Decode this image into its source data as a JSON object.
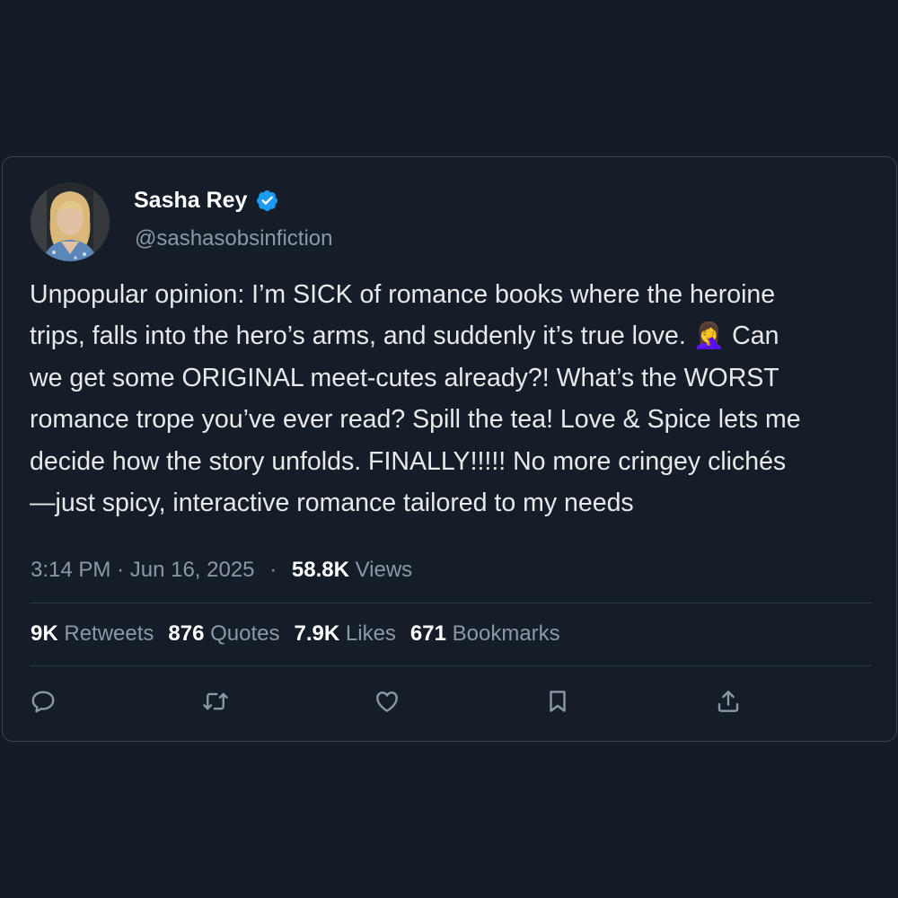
{
  "tweet": {
    "display_name": "Sasha Rey",
    "verified": true,
    "handle": "@sashasobsinfiction",
    "text": "Unpopular opinion: I’m SICK of romance books where the heroine\ntrips, falls into the hero’s arms, and suddenly it’s true love. 🤦‍♀️  Can\nwe get some ORIGINAL meet-cutes already?! What’s the WORST\nromance trope you’ve ever read? Spill the tea! Love & Spice lets me\ndecide how the story unfolds. FINALLY!!!!! No more cringey clichés\n—just spicy, interactive romance tailored to my needs",
    "time": "3:14 PM",
    "date": "Jun 16, 2025",
    "separator": "·",
    "views_count": "58.8K",
    "views_label": "Views"
  },
  "stats": [
    {
      "count": "9K",
      "label": "Retweets"
    },
    {
      "count": "876",
      "label": "Quotes"
    },
    {
      "count": "7.9K",
      "label": "Likes"
    },
    {
      "count": "671",
      "label": "Bookmarks"
    }
  ],
  "actions": {
    "reply": "reply-icon",
    "retweet": "retweet-icon",
    "like": "heart-icon",
    "bookmark": "bookmark-icon",
    "share": "share-icon"
  },
  "colors": {
    "background": "#141c25",
    "card": "#151d28",
    "text": "#e7e9ea",
    "secondary": "#8b98a5",
    "verified": "#1d9bf0"
  }
}
